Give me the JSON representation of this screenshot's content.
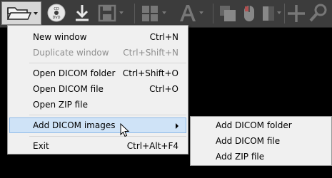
{
  "toolbar": {
    "buttons": [
      {
        "name": "open-folder",
        "icon": "folder-open-icon",
        "has_dropdown": true,
        "active": true
      },
      {
        "name": "cd-dvd",
        "icon": "cd-dvd-icon",
        "disc_label_top": "CD",
        "disc_label_bottom": "DVD"
      },
      {
        "name": "download",
        "icon": "download-icon"
      },
      {
        "name": "save",
        "icon": "floppy-disk-icon",
        "has_dropdown": true,
        "disabled": true
      },
      {
        "name": "layout",
        "icon": "grid-layout-icon",
        "has_dropdown": true,
        "disabled": true
      },
      {
        "name": "annotation",
        "icon": "text-a-icon",
        "has_dropdown": true,
        "disabled": true
      },
      {
        "name": "copy",
        "icon": "copy-images-icon",
        "disabled": true
      },
      {
        "name": "mouse",
        "icon": "mouse-icon",
        "disabled": true
      },
      {
        "name": "window-level",
        "icon": "contrast-icon",
        "has_dropdown": true,
        "disabled": true
      },
      {
        "name": "pan",
        "icon": "move-cross-icon",
        "disabled": true
      },
      {
        "name": "zoom",
        "icon": "magnifier-icon",
        "disabled": true
      }
    ]
  },
  "menu": {
    "items": [
      {
        "label": "New window",
        "shortcut": "Ctrl+N",
        "enabled": true
      },
      {
        "label": "Duplicate window",
        "shortcut": "Ctrl+Shift+N",
        "enabled": false
      },
      {
        "label": "Open DICOM folder",
        "shortcut": "Ctrl+Shift+O",
        "enabled": true
      },
      {
        "label": "Open DICOM file",
        "shortcut": "Ctrl+O",
        "enabled": true
      },
      {
        "label": "Open ZIP file",
        "shortcut": "",
        "enabled": true
      },
      {
        "label": "Add DICOM images",
        "shortcut": "",
        "enabled": true,
        "submenu": true,
        "highlighted": true
      },
      {
        "label": "Exit",
        "shortcut": "Ctrl+Alt+F4",
        "enabled": true
      }
    ]
  },
  "submenu": {
    "items": [
      {
        "label": "Add DICOM folder"
      },
      {
        "label": "Add DICOM file"
      },
      {
        "label": "Add ZIP file"
      }
    ]
  },
  "colors": {
    "toolbar_bg": "#3c3c3c",
    "menu_bg": "#f0f0f0",
    "highlight_bg": "#cfe3f7",
    "highlight_border": "#8fbbe8",
    "disabled_text": "#8e8e8e"
  }
}
